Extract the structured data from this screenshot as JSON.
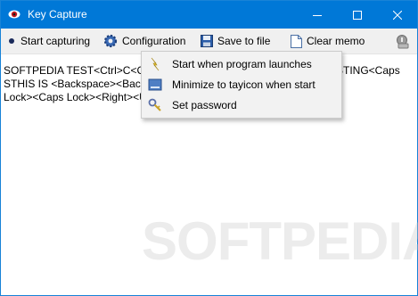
{
  "window": {
    "title": "Key Capture"
  },
  "toolbar": {
    "start_label": "Start capturing",
    "config_label": "Configuration",
    "save_label": "Save to file",
    "clear_label": "Clear memo"
  },
  "memo": {
    "lines": [
      "SOFTPEDIA TEST<Ctrl>C<Ctrl><",
      "STHIS IS <Backspace><Backsp",
      "Lock><Caps Lock><Right><Up>"
    ],
    "lines_right": [
      "STING<Caps"
    ]
  },
  "config_menu": {
    "items": [
      {
        "label": "Start when program launches",
        "icon": "lightning-icon"
      },
      {
        "label": "Minimize to tayicon when start",
        "icon": "tray-icon"
      },
      {
        "label": "Set password",
        "icon": "key-icon"
      }
    ]
  },
  "watermark": "SOFTPEDIA"
}
